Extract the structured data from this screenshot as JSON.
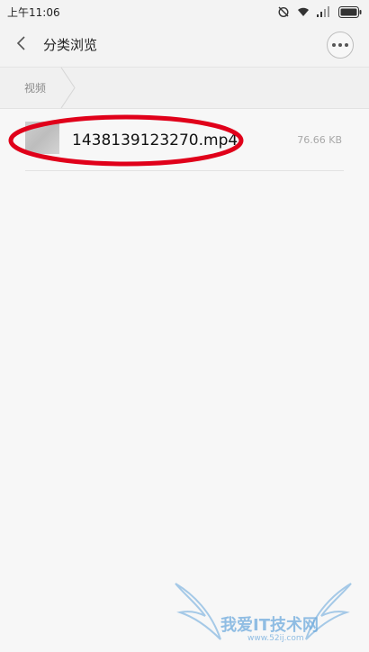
{
  "status_bar": {
    "time": "上午11:06",
    "icons": [
      "alarm-off-icon",
      "wifi-icon",
      "signal-icon",
      "battery-icon"
    ]
  },
  "header": {
    "title": "分类浏览",
    "back_icon": "chevron-left-icon",
    "more_icon": "more-icon"
  },
  "breadcrumb": {
    "items": [
      {
        "label": "视频"
      }
    ]
  },
  "files": [
    {
      "name": "1438139123270.mp4",
      "size": "76.66 KB",
      "thumb_icon": "video-thumbnail"
    }
  ],
  "annotation": {
    "color": "#e0001a",
    "shape": "ellipse"
  },
  "watermark": {
    "text": "我爱IT技术网",
    "url": "www.52ij.com"
  }
}
